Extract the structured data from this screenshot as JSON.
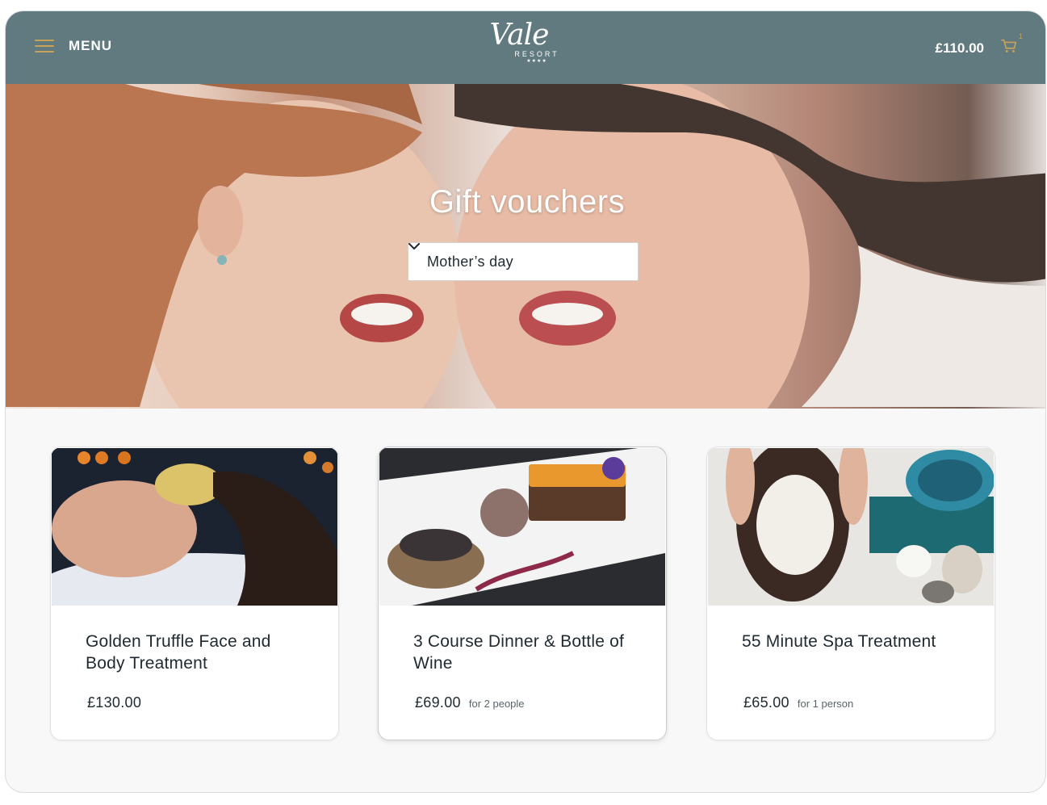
{
  "header": {
    "menu_label": "MENU",
    "logo_script": "Vale",
    "logo_sub": "RESORT",
    "logo_stars": "★★★★",
    "cart_total": "£110.00",
    "cart_count": "1"
  },
  "hero": {
    "title": "Gift vouchers",
    "filter": {
      "selected": "Mother’s day"
    }
  },
  "cards": [
    {
      "title": "Golden Truffle Face and Body Treatment",
      "price": "£130.00",
      "note": ""
    },
    {
      "title": "3 Course Dinner & Bottle of Wine",
      "price": "£69.00",
      "note": "for 2 people"
    },
    {
      "title": "55 Minute Spa Treatment",
      "price": "£65.00",
      "note": "for 1 person"
    }
  ],
  "colors": {
    "header_bg": "#607a80",
    "accent_gold": "#c9a25a",
    "text": "#1f2a30"
  },
  "icons": [
    "menu-icon",
    "cart-icon",
    "chevron-down-icon"
  ]
}
